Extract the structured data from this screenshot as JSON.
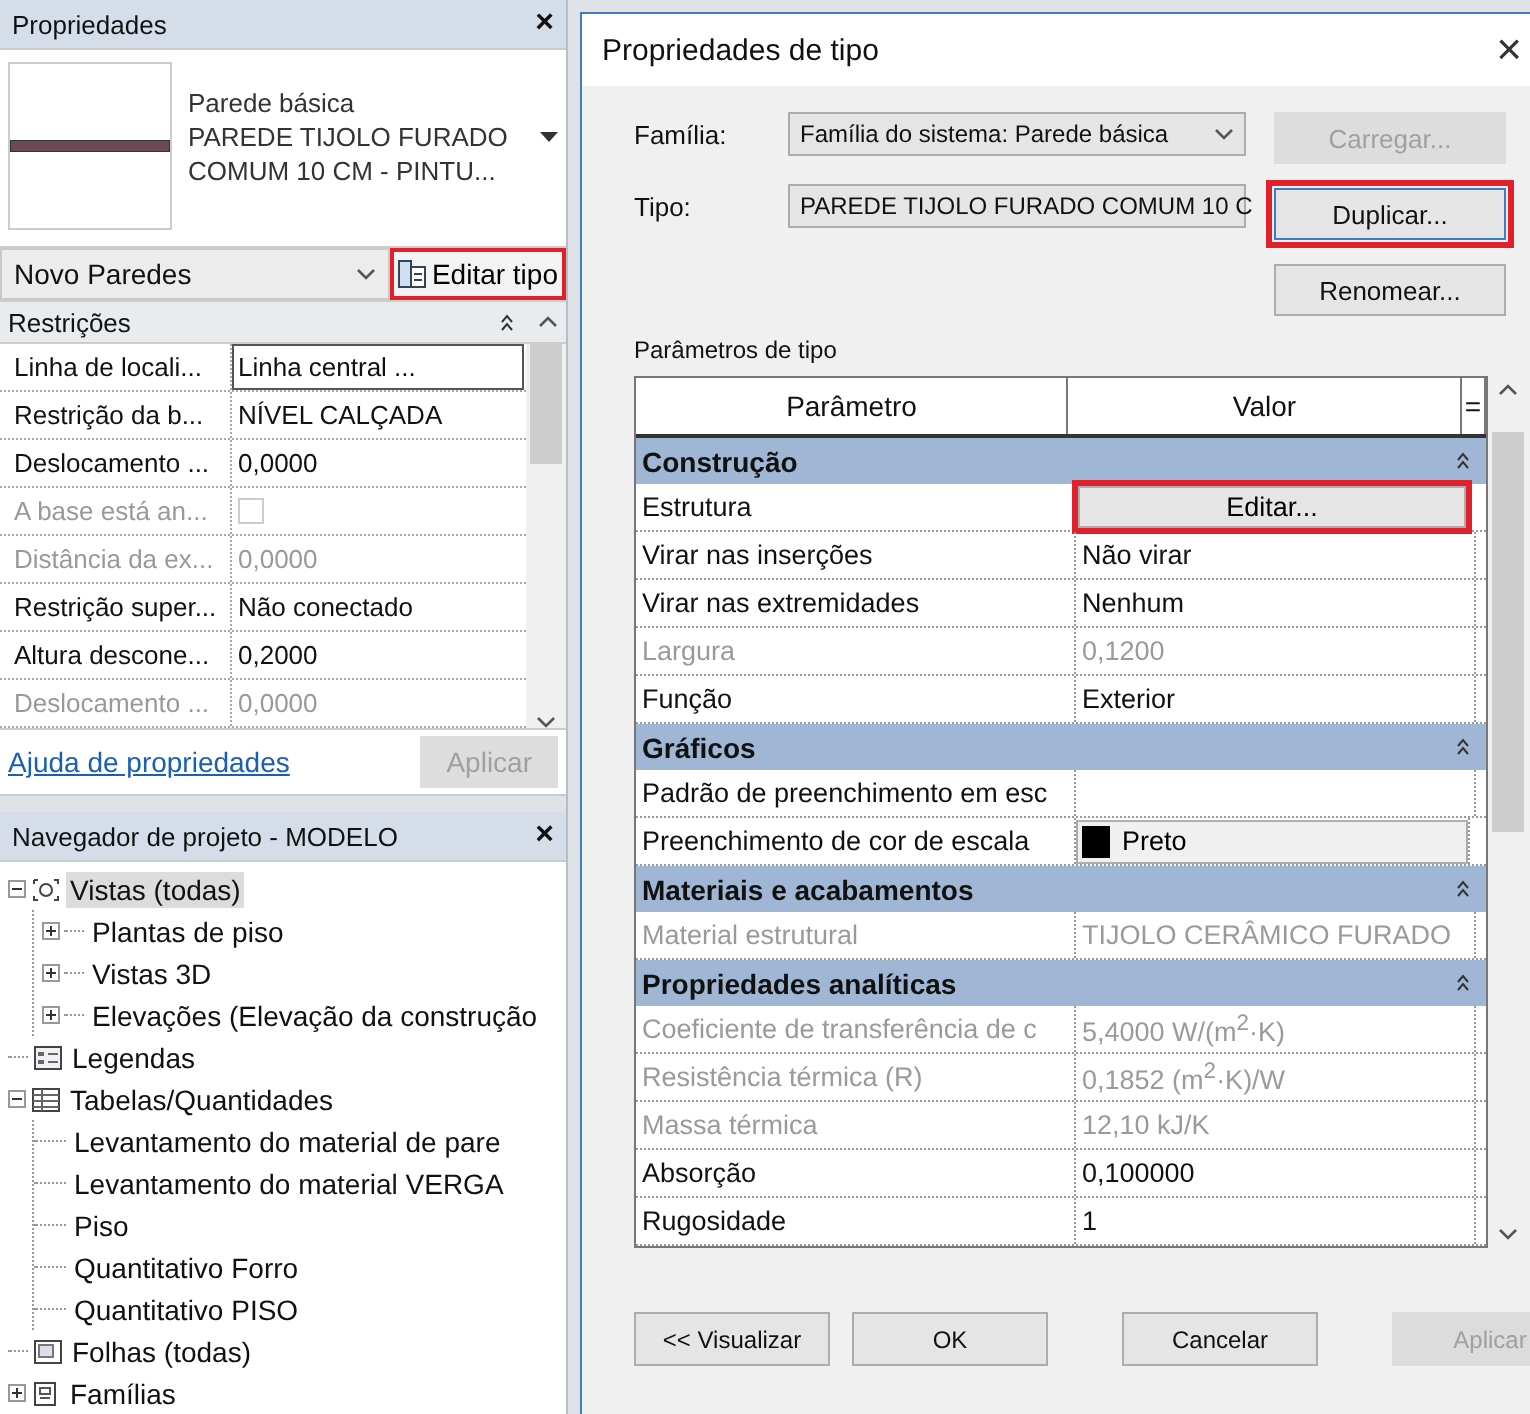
{
  "properties": {
    "title": "Propriedades",
    "close": "×",
    "preview": {
      "family": "Parede básica",
      "type": "PAREDE TIJOLO FURADO COMUM 10 CM - PINTU..."
    },
    "instance_filter": "Novo Paredes",
    "edit_type": {
      "label": "Editar tipo",
      "highlighted": true
    },
    "section": {
      "title": "Restrições",
      "expanded": true
    },
    "rows": [
      {
        "name": "Linha de locali...",
        "value": "Linha central ...",
        "kind": "text",
        "disabled": false,
        "selected": true
      },
      {
        "name": "Restrição da b...",
        "value": "NÍVEL CALÇADA",
        "kind": "text",
        "disabled": false,
        "selected": false
      },
      {
        "name": "Deslocamento ...",
        "value": "0,0000",
        "kind": "text",
        "disabled": false,
        "selected": false
      },
      {
        "name": "A base está an...",
        "kind": "checkbox",
        "checked": false,
        "disabled": true,
        "selected": false
      },
      {
        "name": "Distância da ex...",
        "value": "0,0000",
        "kind": "text",
        "disabled": true,
        "selected": false
      },
      {
        "name": "Restrição super...",
        "value": "Não conectado",
        "kind": "text",
        "disabled": false,
        "selected": false
      },
      {
        "name": "Altura descone...",
        "value": "0,2000",
        "kind": "text",
        "disabled": false,
        "selected": false
      },
      {
        "name": "Deslocamento ...",
        "value": "0,0000",
        "kind": "text",
        "disabled": true,
        "selected": false
      }
    ],
    "help_link": "Ajuda de propriedades",
    "apply": {
      "label": "Aplicar",
      "disabled": true
    }
  },
  "navigator": {
    "title": "Navegador de projeto - MODELO",
    "close": "×",
    "tree": [
      {
        "label": "Vistas (todas)",
        "kind": "views",
        "expanded": true,
        "selected": true,
        "children": [
          {
            "label": "Plantas de piso",
            "expanded": false,
            "selected": false
          },
          {
            "label": "Vistas 3D",
            "expanded": false,
            "selected": false
          },
          {
            "label": "Elevações (Elevação da construção",
            "expanded": false,
            "selected": false
          }
        ]
      },
      {
        "label": "Legendas",
        "kind": "legend",
        "selected": false
      },
      {
        "label": "Tabelas/Quantidades",
        "kind": "schedule",
        "expanded": true,
        "selected": false,
        "children": [
          {
            "label": "Levantamento do material de pare",
            "selected": false
          },
          {
            "label": "Levantamento do material VERGA",
            "selected": false
          },
          {
            "label": "Piso",
            "selected": false
          },
          {
            "label": "Quantitativo Forro",
            "selected": false
          },
          {
            "label": "Quantitativo PISO",
            "selected": false
          }
        ]
      },
      {
        "label": "Folhas (todas)",
        "kind": "sheet",
        "selected": false
      },
      {
        "label": "Famílias",
        "kind": "family",
        "expanded": false,
        "selected": false
      }
    ]
  },
  "dialog": {
    "title": "Propriedades de tipo",
    "close": "×",
    "family": {
      "label": "Família:",
      "value": "Família do sistema: Parede básica"
    },
    "type": {
      "label": "Tipo:",
      "value": "PAREDE TIJOLO FURADO COMUM 10 C"
    },
    "side_buttons": [
      {
        "label": "Carregar...",
        "disabled": true,
        "highlighted": false
      },
      {
        "label": "Duplicar...",
        "disabled": false,
        "highlighted": true
      },
      {
        "label": "Renomear...",
        "disabled": false,
        "highlighted": false
      }
    ],
    "params_label": "Parâmetros de tipo",
    "columns": [
      "Parâmetro",
      "Valor",
      "="
    ],
    "groups": [
      {
        "title": "Construção",
        "expanded": true,
        "rows": [
          {
            "name": "Estrutura",
            "value": "Editar...",
            "kind": "button",
            "disabled": false,
            "highlighted": true
          },
          {
            "name": "Virar nas inserções",
            "value": "Não virar",
            "kind": "text",
            "disabled": false
          },
          {
            "name": "Virar nas extremidades",
            "value": "Nenhum",
            "kind": "text",
            "disabled": false
          },
          {
            "name": "Largura",
            "value": "0,1200",
            "kind": "text",
            "disabled": true
          },
          {
            "name": "Função",
            "value": "Exterior",
            "kind": "text",
            "disabled": false
          }
        ]
      },
      {
        "title": "Gráficos",
        "expanded": true,
        "rows": [
          {
            "name": "Padrão de preenchimento em esc",
            "kind": "empty",
            "disabled": false
          },
          {
            "name": "Preenchimento de cor de escala",
            "value": "Preto",
            "kind": "color",
            "color": "#000000",
            "disabled": false
          }
        ]
      },
      {
        "title": "Materiais e acabamentos",
        "expanded": true,
        "rows": [
          {
            "name": "Material estrutural",
            "value": "TIJOLO CERÂMICO FURADO",
            "kind": "text",
            "disabled": true
          }
        ]
      },
      {
        "title": "Propriedades analíticas",
        "expanded": true,
        "rows": [
          {
            "name": "Coeficiente de transferência de c",
            "value": "5,4000 W/(m$^{2}$·K)",
            "kind": "text",
            "disabled": true
          },
          {
            "name": "Resistência térmica (R)",
            "value": "0,1852 (m$^{2}$·K)/W",
            "kind": "text",
            "disabled": true
          },
          {
            "name": "Massa térmica",
            "value": "12,10 kJ/K",
            "kind": "text",
            "disabled": true
          },
          {
            "name": "Absorção",
            "value": "0,100000",
            "kind": "text",
            "disabled": false
          },
          {
            "name": "Rugosidade",
            "value": "1",
            "kind": "text",
            "disabled": false
          }
        ]
      }
    ],
    "footer_buttons": [
      {
        "label": "<< Visualizar",
        "disabled": false
      },
      {
        "label": "OK",
        "disabled": false
      },
      {
        "label": "Cancelar",
        "disabled": false
      },
      {
        "label": "Aplicar",
        "disabled": true
      }
    ]
  }
}
